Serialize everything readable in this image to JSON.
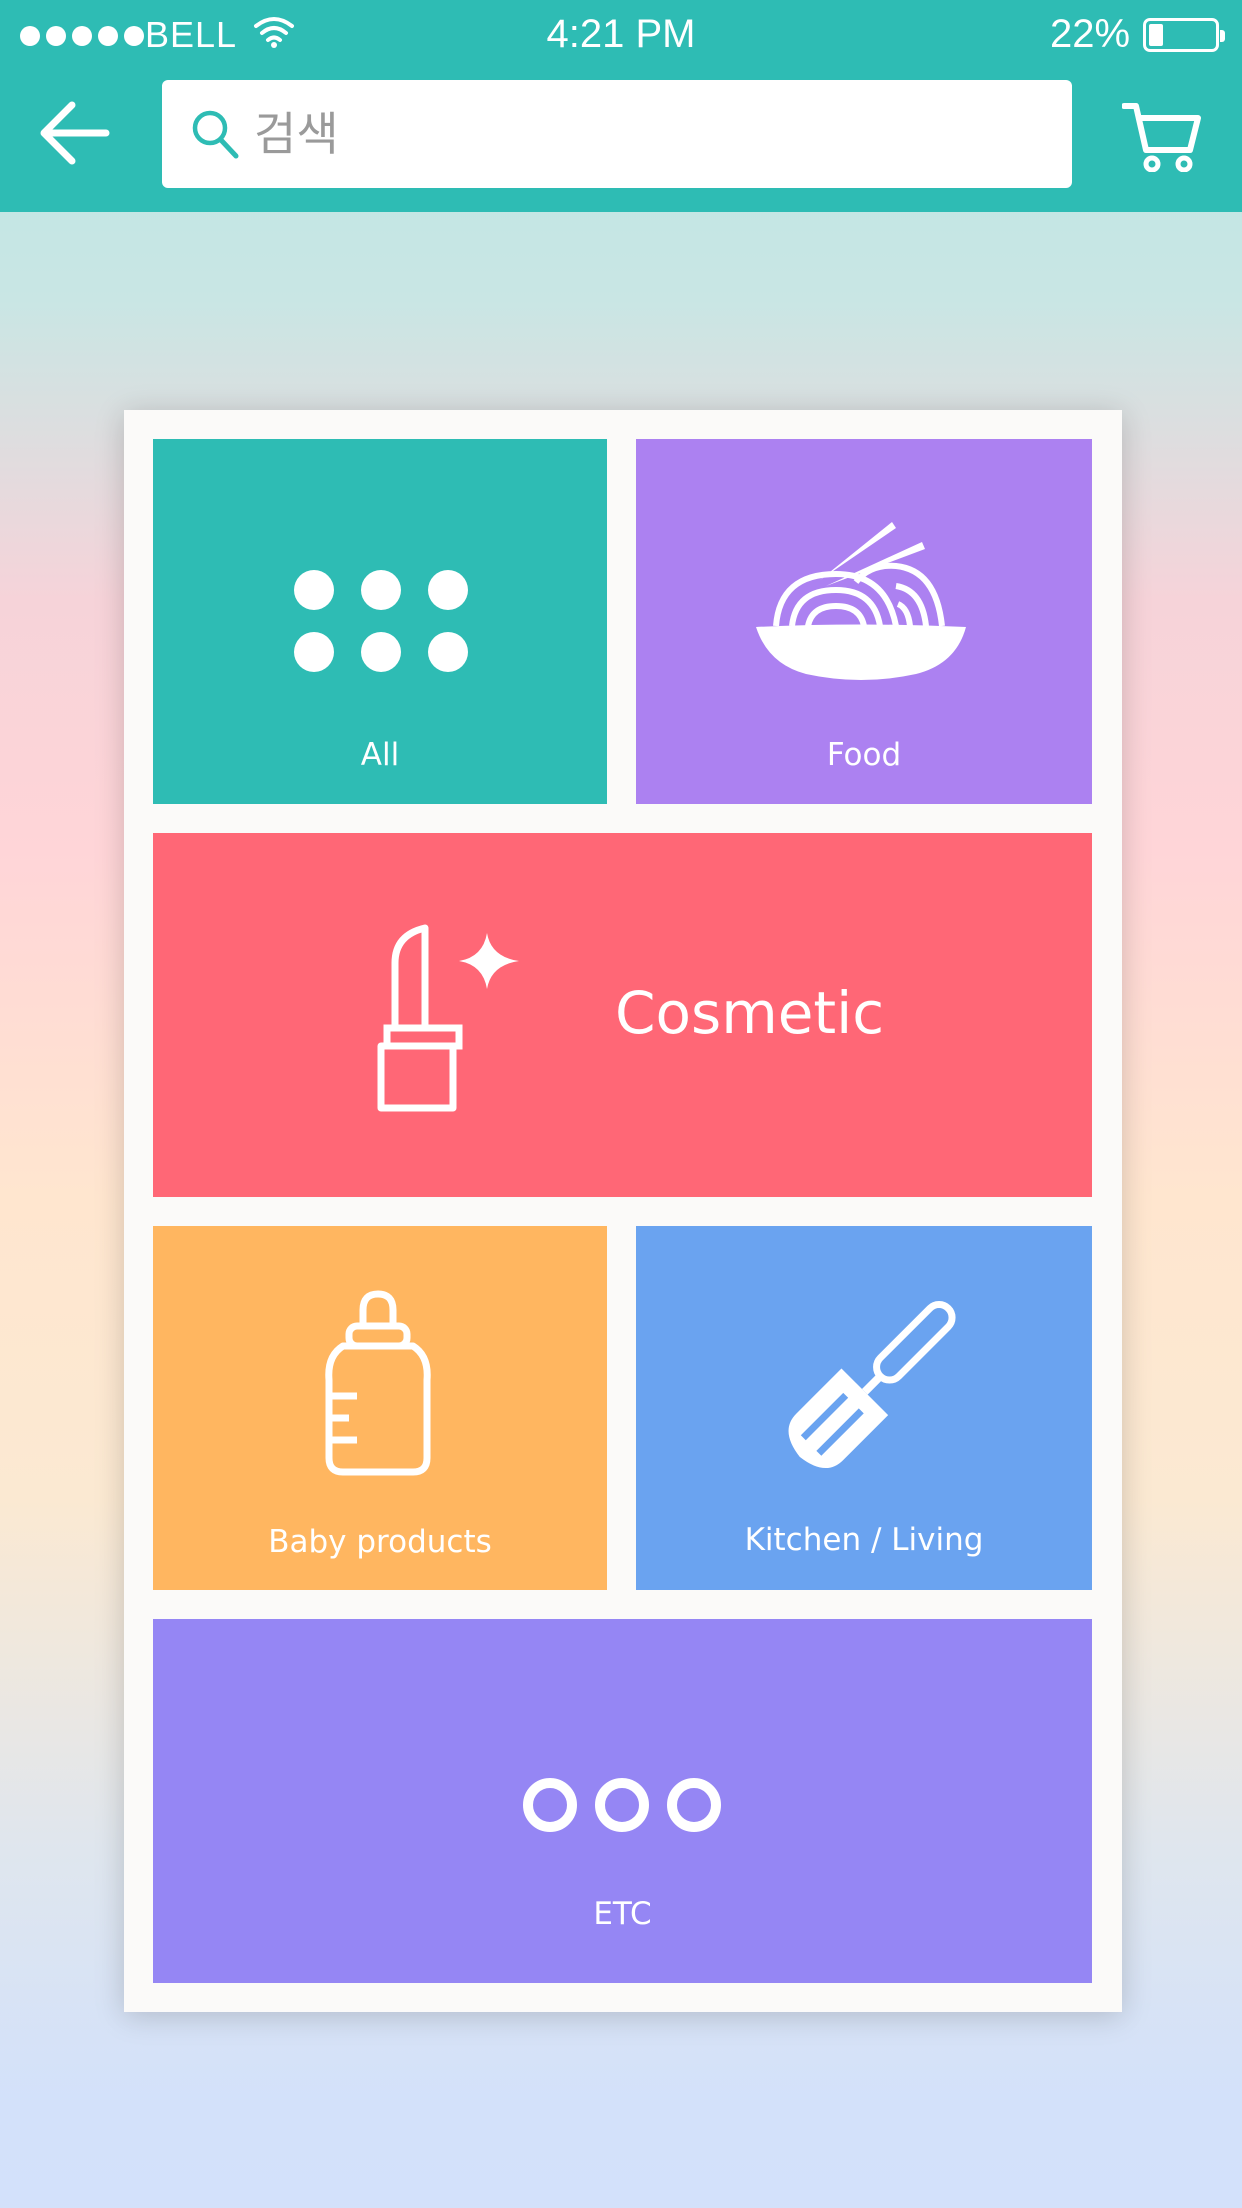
{
  "status_bar": {
    "carrier": "BELL",
    "time": "4:21 PM",
    "battery_percent": "22%",
    "battery_level": 0.22
  },
  "header": {
    "back_icon": "arrow-left-icon",
    "search_placeholder": "검색",
    "search_value": "",
    "search_icon": "magnifier-icon",
    "cart_icon": "shopping-cart-icon"
  },
  "categories": [
    {
      "label": "All",
      "icon": "grid-dots-icon",
      "color": "#2ebcb4"
    },
    {
      "label": "Food",
      "icon": "noodle-bowl-icon",
      "color": "#ac81f1"
    },
    {
      "label": "Cosmetic",
      "icon": "lipstick-icon",
      "color": "#ff6776"
    },
    {
      "label": "Baby products",
      "icon": "baby-bottle-icon",
      "color": "#ffb660"
    },
    {
      "label": "Kitchen /  Living",
      "icon": "spatula-icon",
      "color": "#6aa3f0"
    },
    {
      "label": "ETC",
      "icon": "more-circles-icon",
      "color": "#9586f4"
    }
  ],
  "colors": {
    "accent": "#2ebcb4",
    "card_background": "#fbfaf9"
  }
}
